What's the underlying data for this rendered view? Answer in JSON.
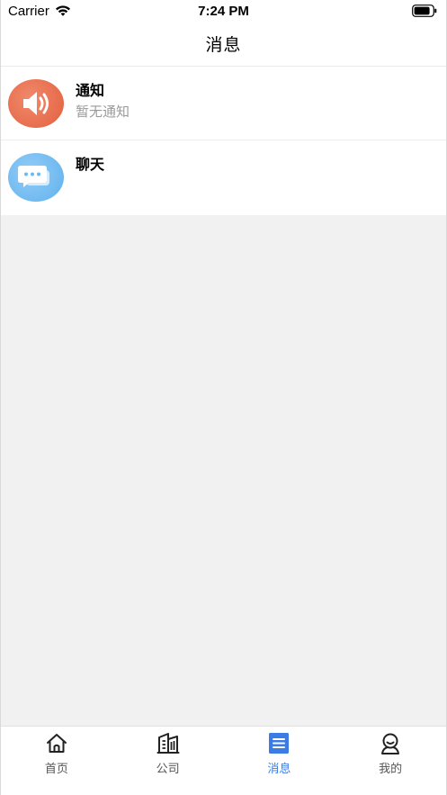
{
  "status_bar": {
    "carrier": "Carrier",
    "time": "7:24 PM"
  },
  "header": {
    "title": "消息"
  },
  "messages": [
    {
      "title": "通知",
      "subtitle": "暂无通知",
      "icon": "speaker-icon",
      "color": "#e76c4c"
    },
    {
      "title": "聊天",
      "subtitle": "",
      "icon": "chat-bubble-icon",
      "color": "#6fb9f0"
    }
  ],
  "tab_bar": {
    "active_color": "#3b7be6",
    "tabs": [
      {
        "label": "首页",
        "icon": "home-icon",
        "active": false
      },
      {
        "label": "公司",
        "icon": "building-icon",
        "active": false
      },
      {
        "label": "消息",
        "icon": "message-list-icon",
        "active": true
      },
      {
        "label": "我的",
        "icon": "profile-icon",
        "active": false
      }
    ]
  }
}
